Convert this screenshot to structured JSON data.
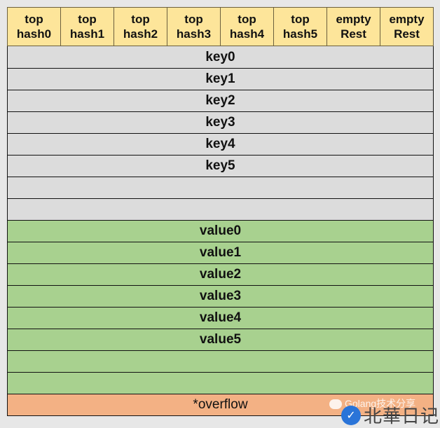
{
  "header": {
    "cells": [
      {
        "line1": "top",
        "line2": "hash0"
      },
      {
        "line1": "top",
        "line2": "hash1"
      },
      {
        "line1": "top",
        "line2": "hash2"
      },
      {
        "line1": "top",
        "line2": "hash3"
      },
      {
        "line1": "top",
        "line2": "hash4"
      },
      {
        "line1": "top",
        "line2": "hash5"
      },
      {
        "line1": "empty",
        "line2": "Rest"
      },
      {
        "line1": "empty",
        "line2": "Rest"
      }
    ]
  },
  "keys": [
    "key0",
    "key1",
    "key2",
    "key3",
    "key4",
    "key5",
    "",
    ""
  ],
  "values": [
    "value0",
    "value1",
    "value2",
    "value3",
    "value4",
    "value5",
    "",
    ""
  ],
  "overflow": "*overflow",
  "watermark": {
    "caption": "Golang技术分享",
    "logo_text": "北華日记",
    "logo_icon": "check-badge-icon"
  },
  "colors": {
    "header": "#fde59a",
    "key_rows": "#dcdcdc",
    "value_rows": "#a8d18f",
    "overflow_row": "#f3b184"
  }
}
